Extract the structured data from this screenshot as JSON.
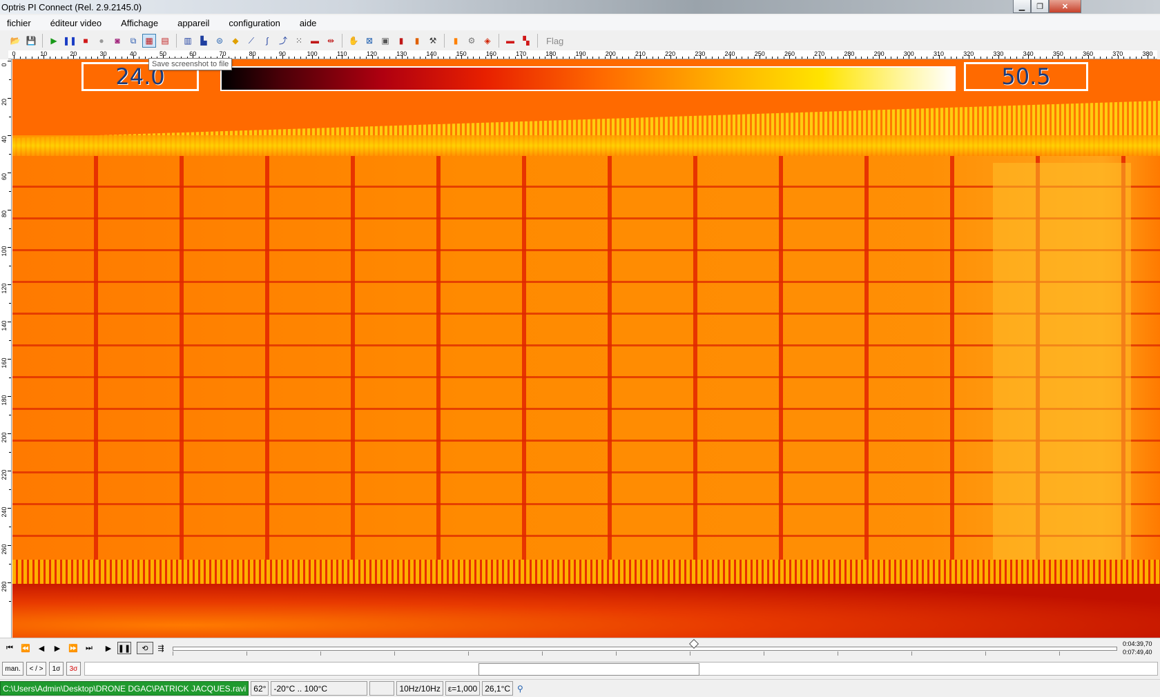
{
  "window": {
    "title": "Optris PI Connect (Rel. 2.9.2145.0)",
    "minimize_icon": "minimize-icon",
    "maximize_icon": "maximize-icon",
    "close_icon": "close-icon"
  },
  "menu": {
    "items": [
      "fichier",
      "éditeur video",
      "Affichage",
      "appareil",
      "configuration",
      "aide"
    ]
  },
  "toolbar": {
    "flag_label": "Flag",
    "tooltip": "Save screenshot to file",
    "icons": [
      "open-folder-icon",
      "save-icon",
      "play-icon",
      "pause-icon",
      "stop-icon",
      "record-icon",
      "camera-icon",
      "copy-icon",
      "save-screenshot-icon",
      "layout-icon",
      "table-icon",
      "histogram-icon",
      "profile-icon",
      "fill-icon",
      "line-graph-icon",
      "chart-icon",
      "scale-icon",
      "grid-icon",
      "measure-icon",
      "ruler-icon",
      "hand-icon",
      "zoom-fit-icon",
      "crop-icon",
      "palette-icon",
      "palette-alt-icon",
      "tools-icon",
      "color-bar-icon",
      "config-icon",
      "flag-palette-icon",
      "ir-icon",
      "export-icon"
    ]
  },
  "rulers": {
    "horizontal": [
      "0",
      "10",
      "20",
      "30",
      "40",
      "50",
      "60",
      "70",
      "80",
      "90",
      "100",
      "110",
      "120",
      "130",
      "140",
      "150",
      "160",
      "170",
      "180",
      "190",
      "200",
      "210",
      "220",
      "230",
      "240",
      "250",
      "260",
      "270",
      "280",
      "290",
      "300",
      "310",
      "320",
      "330",
      "340",
      "350",
      "360",
      "370",
      "380"
    ],
    "vertical": [
      "0",
      "20",
      "40",
      "60",
      "80",
      "100",
      "120",
      "140",
      "160",
      "180",
      "200",
      "220",
      "240",
      "260",
      "280"
    ]
  },
  "color_scale": {
    "min": "24.0",
    "max": "50.5",
    "palette_colors": [
      "#000000",
      "#b00010",
      "#ff6a00",
      "#ffe400",
      "#ffffff"
    ]
  },
  "playback": {
    "buttons": [
      "skip-start-icon",
      "rewind-icon",
      "step-back-icon",
      "step-forward-icon",
      "fast-forward-icon",
      "skip-end-icon",
      "play-icon",
      "pause-icon",
      "loop-icon",
      "sequence-icon"
    ],
    "position_fraction": 0.552,
    "time_current": "0:04:39,70",
    "time_total": "0:07:49,40"
  },
  "modes": {
    "man": "man.",
    "range": "< / >",
    "one_sigma": "1σ",
    "three_sigma": "3σ"
  },
  "status": {
    "path": "C:\\Users\\Admin\\Desktop\\DRONE DGAC\\PATRICK JACQUES.ravi",
    "fov": "62°",
    "temp_range": "-20°C .. 100°C",
    "blank": "",
    "framerate": "10Hz/10Hz",
    "emissivity": "ε=1,000",
    "ambient": "26,1°C",
    "location_icon": "pin-icon"
  },
  "colors": {
    "path_bg": "#1f9a2e",
    "three_sigma_text": "#d40000"
  }
}
